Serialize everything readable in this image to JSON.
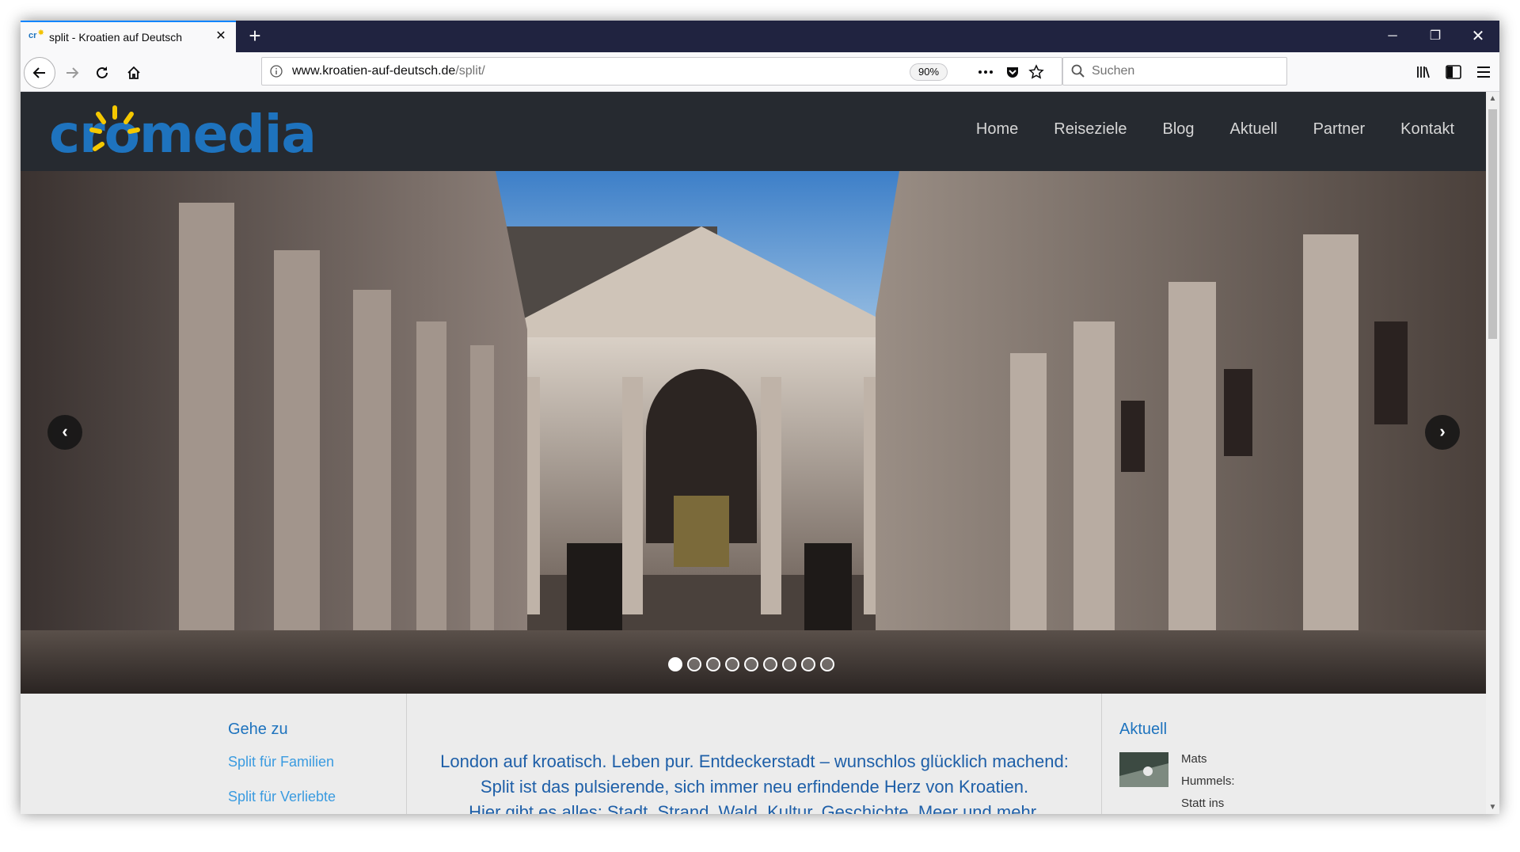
{
  "browser": {
    "tab_title": "split - Kroatien auf Deutsch",
    "favicon_text": "cr",
    "url_host": "www.kroatien-auf-deutsch.de",
    "url_path": "/split/",
    "zoom": "90%",
    "search_placeholder": "Suchen",
    "accent_color": "#0a84ff"
  },
  "site": {
    "logo_text": "cromedia",
    "menu": [
      "Home",
      "Reiseziele",
      "Blog",
      "Aktuell",
      "Partner",
      "Kontakt"
    ],
    "slider": {
      "total_slides": 9,
      "active_slide": 1
    }
  },
  "sidebar": {
    "heading": "Gehe zu",
    "links": [
      "Split für Familien",
      "Split für Verliebte"
    ]
  },
  "main": {
    "intro_lines": [
      "London auf kroatisch. Leben pur. Entdeckerstadt – wunschlos glücklich machend:",
      "Split ist das pulsierende, sich immer neu erfindende Herz von Kroatien.",
      "Hier gibt es alles: Stadt, Strand, Wald, Kultur, Geschichte, Meer und mehr."
    ]
  },
  "aktuell": {
    "heading": "Aktuell",
    "news_lines": [
      "Mats",
      "Hummels:",
      "Statt ins"
    ]
  },
  "colors": {
    "brand_blue": "#1e73be",
    "header_bg": "#262a30",
    "link_blue": "#3a9be0"
  }
}
